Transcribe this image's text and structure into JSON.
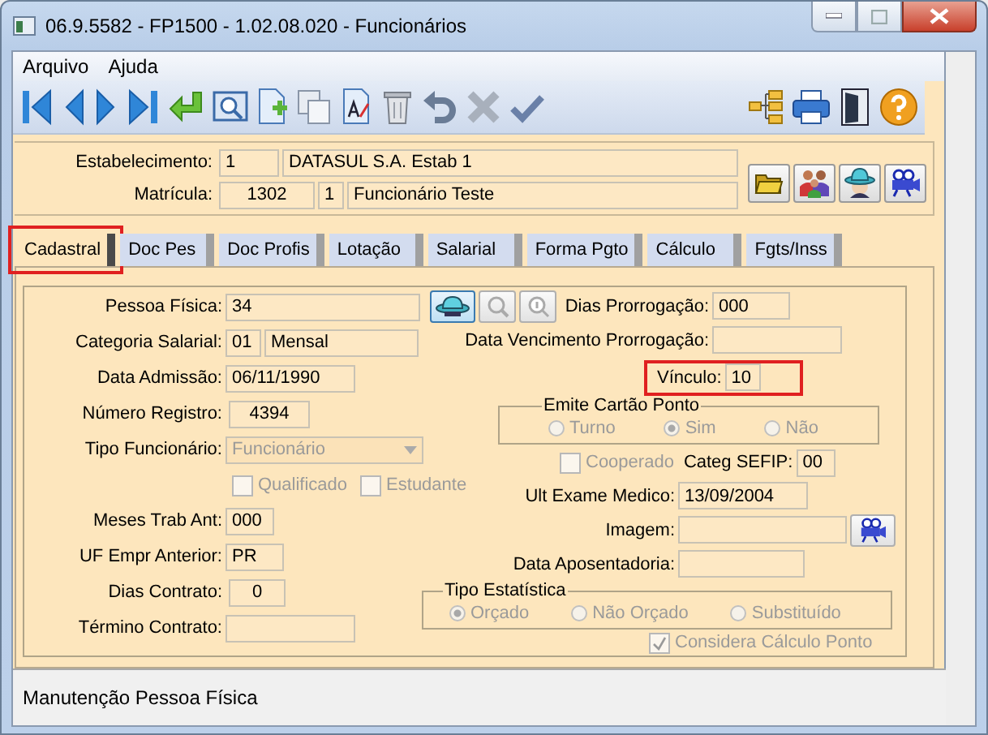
{
  "window": {
    "title": "06.9.5582 - FP1500 - 1.02.08.020 - Funcionários"
  },
  "menu": [
    "Arquivo",
    "Ajuda"
  ],
  "header": {
    "establishment": {
      "label": "Estabelecimento:",
      "code": "1",
      "name": "DATASUL S.A. Estab 1"
    },
    "registration": {
      "label": "Matrícula:",
      "number": "1302",
      "digit": "1",
      "name": "Funcionário Teste"
    }
  },
  "tabs": [
    {
      "label": "Cadastral",
      "selected": true,
      "highlighted": true
    },
    {
      "label": "Doc Pes",
      "selected": false,
      "highlighted": false
    },
    {
      "label": "Doc Profis",
      "selected": false,
      "highlighted": false
    },
    {
      "label": "Lotação",
      "selected": false,
      "highlighted": false
    },
    {
      "label": "Salarial",
      "selected": false,
      "highlighted": false
    },
    {
      "label": "Forma Pgto",
      "selected": false,
      "highlighted": false
    },
    {
      "label": "Cálculo",
      "selected": false,
      "highlighted": false
    },
    {
      "label": "Fgts/Inss",
      "selected": false,
      "highlighted": false
    }
  ],
  "form": {
    "pessoa_fisica": {
      "label": "Pessoa Física:",
      "value": "34"
    },
    "categoria_salarial": {
      "label": "Categoria Salarial:",
      "code": "01",
      "name": "Mensal"
    },
    "data_admissao": {
      "label": "Data Admissão:",
      "value": "06/11/1990"
    },
    "numero_registro": {
      "label": "Número Registro:",
      "value": "4394"
    },
    "tipo_funcionario": {
      "label": "Tipo Funcionário:",
      "value": "Funcionário",
      "disabled": true
    },
    "checks": [
      {
        "label": "Qualificado",
        "checked": false,
        "disabled": true
      },
      {
        "label": "Estudante",
        "checked": false,
        "disabled": true
      }
    ],
    "meses_trab_ant": {
      "label": "Meses Trab Ant:",
      "value": "000"
    },
    "uf_empr_anterior": {
      "label": "UF Empr Anterior:",
      "value": "PR"
    },
    "dias_contrato": {
      "label": "Dias Contrato:",
      "value": "0"
    },
    "termino_contrato": {
      "label": "Término Contrato:"
    },
    "dias_prorrogacao": {
      "label": "Dias Prorrogação:",
      "value": "000"
    },
    "data_vencimento_prorrogacao": {
      "label": "Data Vencimento Prorrogação:"
    },
    "vinculo": {
      "label": "Vínculo:",
      "value": "10",
      "highlighted": true
    },
    "emite_cartao_ponto": {
      "title": "Emite Cartão Ponto",
      "disabled": true,
      "options": [
        {
          "label": "Turno",
          "selected": false
        },
        {
          "label": "Sim",
          "selected": true
        },
        {
          "label": "Não",
          "selected": false
        }
      ]
    },
    "cooperado": {
      "label": "Cooperado",
      "checked": false,
      "disabled": true
    },
    "categ_sefip": {
      "label": "Categ SEFIP:",
      "value": "00"
    },
    "ult_exame_medico": {
      "label": "Ult Exame Medico:",
      "value": "13/09/2004"
    },
    "imagem": {
      "label": "Imagem:"
    },
    "data_aposentadoria": {
      "label": "Data Aposentadoria:"
    },
    "tipo_estatistica": {
      "title": "Tipo Estatística",
      "disabled": true,
      "options": [
        {
          "label": "Orçado",
          "selected": true
        },
        {
          "label": "Não Orçado",
          "selected": false
        },
        {
          "label": "Substituído",
          "selected": false
        }
      ]
    },
    "considera_calculo_ponto": {
      "label": "Considera Cálculo Ponto",
      "checked": true,
      "disabled": true
    }
  },
  "status_bar": "Manutenção Pessoa Física"
}
